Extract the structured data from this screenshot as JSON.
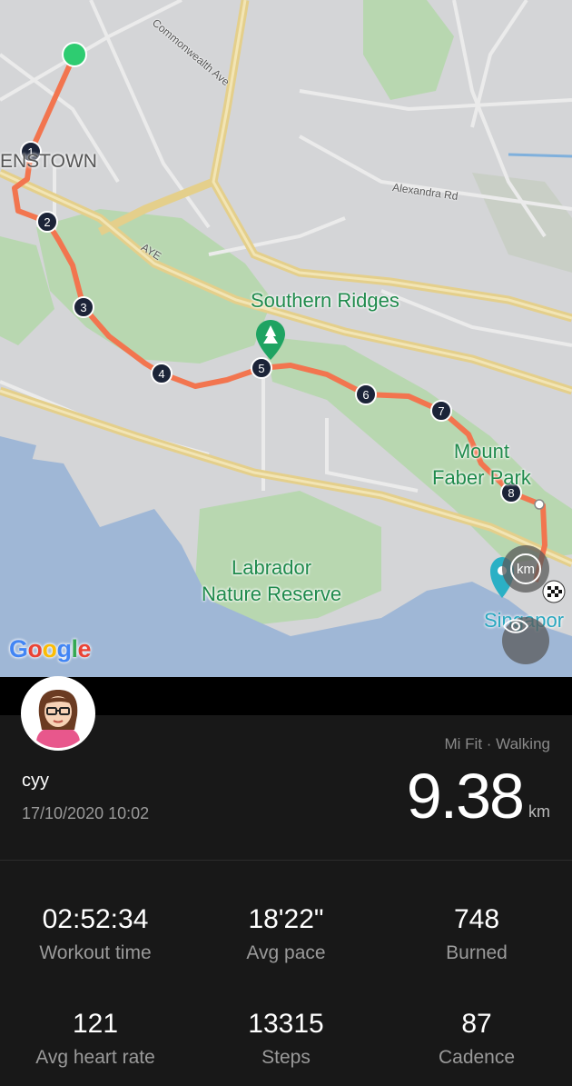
{
  "map": {
    "labels": {
      "southern_ridges": "Southern Ridges",
      "mount_faber": "Mount\nFaber Park",
      "labrador": "Labrador\nNature Reserve",
      "singapore": "Singapor",
      "queenstown": "ENSTOWN",
      "commonwealth": "Commonwealth Ave",
      "alexandra": "Alexandra Rd",
      "aye": "AYE"
    },
    "markers": [
      "1",
      "2",
      "3",
      "4",
      "5",
      "6",
      "7",
      "8"
    ],
    "google": "Google",
    "buttons": {
      "unit_toggle": "km",
      "view_toggle": "eye-icon"
    },
    "route_color": "#f2754f",
    "start_color": "#2ecc71"
  },
  "workout": {
    "user": "cyy",
    "datetime": "17/10/2020 10:02",
    "source": "Mi Fit · Walking",
    "distance": "9.38",
    "distance_unit": "km"
  },
  "stats": [
    {
      "value": "02:52:34",
      "label": "Workout time"
    },
    {
      "value": "18'22\"",
      "label": "Avg pace"
    },
    {
      "value": "748",
      "label": "Burned"
    },
    {
      "value": "121",
      "label": "Avg heart rate"
    },
    {
      "value": "13315",
      "label": "Steps"
    },
    {
      "value": "87",
      "label": "Cadence"
    }
  ]
}
